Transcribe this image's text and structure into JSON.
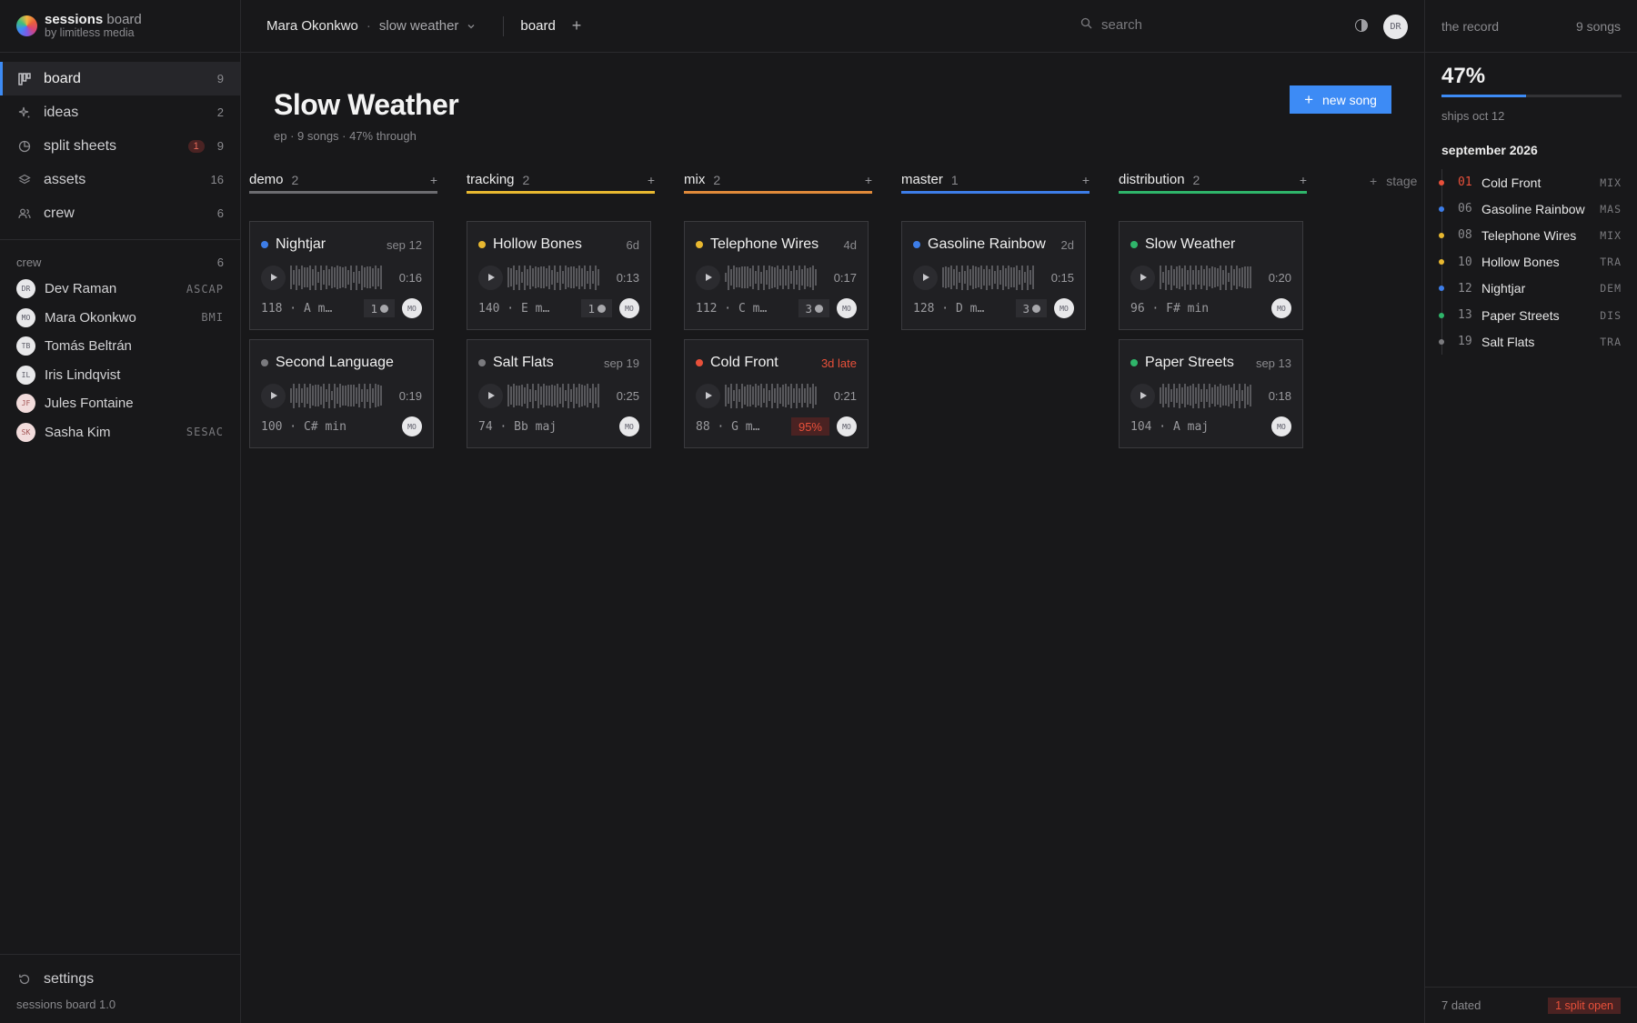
{
  "brand": {
    "name": "sessions",
    "name_light": "board",
    "sub": "by limitless media"
  },
  "nav": [
    {
      "label": "board",
      "count": "9",
      "active": true,
      "icon": "board-icon"
    },
    {
      "label": "ideas",
      "count": "2",
      "icon": "sparkle-icon"
    },
    {
      "label": "split sheets",
      "count": "9",
      "badge": "1",
      "icon": "pie-icon"
    },
    {
      "label": "assets",
      "count": "16",
      "icon": "layers-icon"
    },
    {
      "label": "crew",
      "count": "6",
      "icon": "users-icon"
    }
  ],
  "crew": {
    "title": "crew",
    "count": "6",
    "members": [
      {
        "initials": "DR",
        "name": "Dev Raman",
        "pro": "ASCAP"
      },
      {
        "initials": "MO",
        "name": "Mara Okonkwo",
        "pro": "BMI"
      },
      {
        "initials": "TB",
        "name": "Tomás Beltrán",
        "pro": ""
      },
      {
        "initials": "IL",
        "name": "Iris Lindqvist",
        "pro": ""
      },
      {
        "initials": "JF",
        "name": "Jules Fontaine",
        "pro": ""
      },
      {
        "initials": "SK",
        "name": "Sasha Kim",
        "pro": "SESAC"
      }
    ]
  },
  "settings_label": "settings",
  "version": "sessions board 1.0",
  "topbar": {
    "user": "Mara Okonkwo",
    "sep": "·",
    "project": "slow weather",
    "tab": "board",
    "tab_add": "+",
    "search_placeholder": "search",
    "avatar": "DR"
  },
  "page": {
    "title": "Slow Weather",
    "subtitle": "ep · 9 songs · 47% through",
    "new_song": "new song",
    "add_stage": "stage"
  },
  "columns": [
    {
      "id": "demo",
      "name": "demo",
      "count": "2",
      "cards": [
        {
          "title": "Nightjar",
          "meta": "sep 12",
          "dot": "#3d7de8",
          "dur": "0:16",
          "key": "118 · A m…",
          "chip": "1",
          "avatar": "MO"
        },
        {
          "title": "Second Language",
          "meta": "",
          "dot": "#7a7a7e",
          "dur": "0:19",
          "key": "100 · C# min",
          "avatar": "MO"
        }
      ]
    },
    {
      "id": "tracking",
      "name": "tracking",
      "count": "2",
      "cards": [
        {
          "title": "Hollow Bones",
          "meta": "6d",
          "dot": "#e8b830",
          "dur": "0:13",
          "key": "140 · E m…",
          "chip": "1",
          "avatar": "MO"
        },
        {
          "title": "Salt Flats",
          "meta": "sep 19",
          "dot": "#7a7a7e",
          "dur": "0:25",
          "key": "74 · Bb maj",
          "avatar": "MO"
        }
      ]
    },
    {
      "id": "mix",
      "name": "mix",
      "count": "2",
      "cards": [
        {
          "title": "Telephone Wires",
          "meta": "4d",
          "dot": "#e8b830",
          "dur": "0:17",
          "key": "112 · C m…",
          "chip": "3",
          "avatar": "MO"
        },
        {
          "title": "Cold Front",
          "meta": "3d late",
          "late": true,
          "dot": "#e8503a",
          "dur": "0:21",
          "key": "88 · G m…",
          "pct": "95%",
          "avatar": "MO"
        }
      ]
    },
    {
      "id": "master",
      "name": "master",
      "count": "1",
      "cards": [
        {
          "title": "Gasoline Rainbow",
          "meta": "2d",
          "dot": "#3d7de8",
          "dur": "0:15",
          "key": "128 · D m…",
          "chip": "3",
          "avatar": "MO"
        }
      ]
    },
    {
      "id": "distribution",
      "name": "distribution",
      "count": "2",
      "cards": [
        {
          "title": "Slow Weather",
          "meta": "",
          "dot": "#2fb56a",
          "dur": "0:20",
          "key": "96 · F# min",
          "avatar": "MO"
        },
        {
          "title": "Paper Streets",
          "meta": "sep 13",
          "dot": "#2fb56a",
          "dur": "0:18",
          "key": "104 · A maj",
          "avatar": "MO"
        }
      ]
    }
  ],
  "record": {
    "title": "the record",
    "songs": "9 songs",
    "percent": "47%",
    "progress": 0.47,
    "ships": "ships oct 12",
    "month": "september 2026",
    "items": [
      {
        "num": "01",
        "title": "Cold Front",
        "stage": "MIX",
        "dot": "#e8503a",
        "urgent": true
      },
      {
        "num": "06",
        "title": "Gasoline Rainbow",
        "stage": "MAS",
        "dot": "#3d7de8"
      },
      {
        "num": "08",
        "title": "Telephone Wires",
        "stage": "MIX",
        "dot": "#e8b830"
      },
      {
        "num": "10",
        "title": "Hollow Bones",
        "stage": "TRA",
        "dot": "#e8b830"
      },
      {
        "num": "12",
        "title": "Nightjar",
        "stage": "DEM",
        "dot": "#3d7de8"
      },
      {
        "num": "13",
        "title": "Paper Streets",
        "stage": "DIS",
        "dot": "#2fb56a"
      },
      {
        "num": "19",
        "title": "Salt Flats",
        "stage": "TRA",
        "dot": "#7a7a7e"
      }
    ],
    "dated": "7 dated",
    "split_open": "1 split open"
  },
  "colors": {
    "accent": "#3d8bf5",
    "late": "#e8503a"
  }
}
